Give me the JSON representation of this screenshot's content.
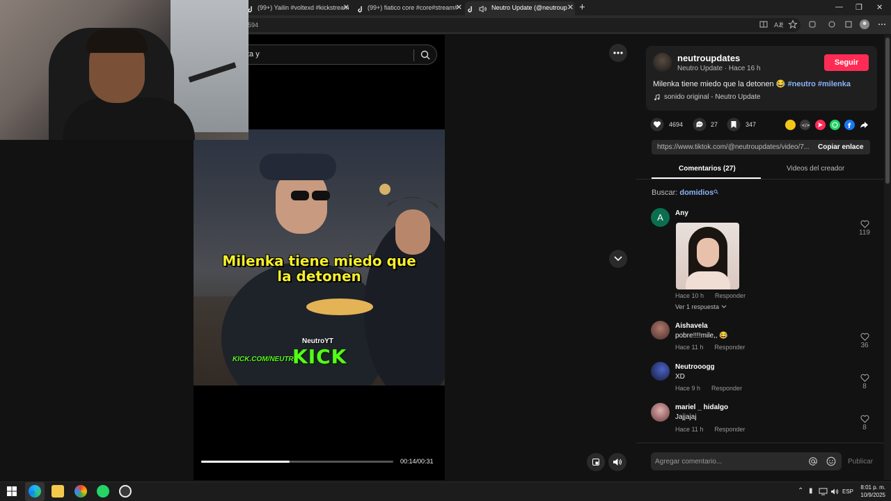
{
  "browser": {
    "tabs": [
      {
        "title": "(99+) Yailin #voltexd #kickstream",
        "close": "✕"
      },
      {
        "title": "(99+) fiatico core #core#stream#",
        "close": "✕"
      },
      {
        "title": "Neutro Update (@neutroup",
        "close": "✕"
      }
    ],
    "new_tab": "+",
    "address_fragment": "594",
    "window_controls": {
      "minimize": "—",
      "maximize": "❐",
      "close": "✕"
    }
  },
  "player": {
    "search_text": "ta y",
    "caption_line1": "Milenka tiene miedo que",
    "caption_line2": "la detonen",
    "watermark_handle": "NeutroYT",
    "watermark_url": "KICK.COM/NEUTRO",
    "watermark_logo": "KICK",
    "current_time": "00:14",
    "duration": "00:31",
    "time_display": "00:14/00:31",
    "progress_fraction": 0.46
  },
  "post": {
    "username": "neutroupdates",
    "author_line": "Neutro Update · Hace 16 h",
    "follow_label": "Seguir",
    "description_text": "Milenka tiene miedo que la detonen 😂",
    "hashtags": [
      "#neutro",
      "#milenka"
    ],
    "sound": "sonido original - Neutro Update",
    "likes": "4694",
    "comments": "27",
    "saves": "347",
    "link": "https://www.tiktok.com/@neutroupdates/video/7...",
    "copy_link_label": "Copiar enlace"
  },
  "panel_tabs": [
    {
      "label": "Comentarios (27)",
      "active": true
    },
    {
      "label": "Videos del creador",
      "active": false
    }
  ],
  "search_hint": {
    "prefix": "Buscar:",
    "term": "domidios"
  },
  "comments": [
    {
      "name": "Any",
      "avatar_letter": "A",
      "text": "",
      "time": "Hace 10 h",
      "reply": "Responder",
      "likes": "119",
      "replies_label": "Ver 1 respuesta"
    },
    {
      "name": "Aishavela",
      "text": "pobre!!!!mile,, 😂",
      "time": "Hace 11 h",
      "reply": "Responder",
      "likes": "36"
    },
    {
      "name": "Neutrooogg",
      "text": "XD",
      "time": "Hace 9 h",
      "reply": "Responder",
      "likes": "8"
    },
    {
      "name": "mariel _ hidalgo",
      "text": "Jajjajaj",
      "time": "Hace 11 h",
      "reply": "Responder",
      "likes": "8"
    }
  ],
  "comment_box": {
    "placeholder": "Agregar comentario...",
    "publish_label": "Publicar"
  },
  "taskbar": {
    "time": "8:01 p. m.",
    "date": "10/9/2025",
    "language": "ESP"
  },
  "colors": {
    "accent": "#fe2c55",
    "hashtag": "#8ab4f8",
    "kick_green": "#53fc18",
    "caption_yellow": "#f5ef2a"
  }
}
